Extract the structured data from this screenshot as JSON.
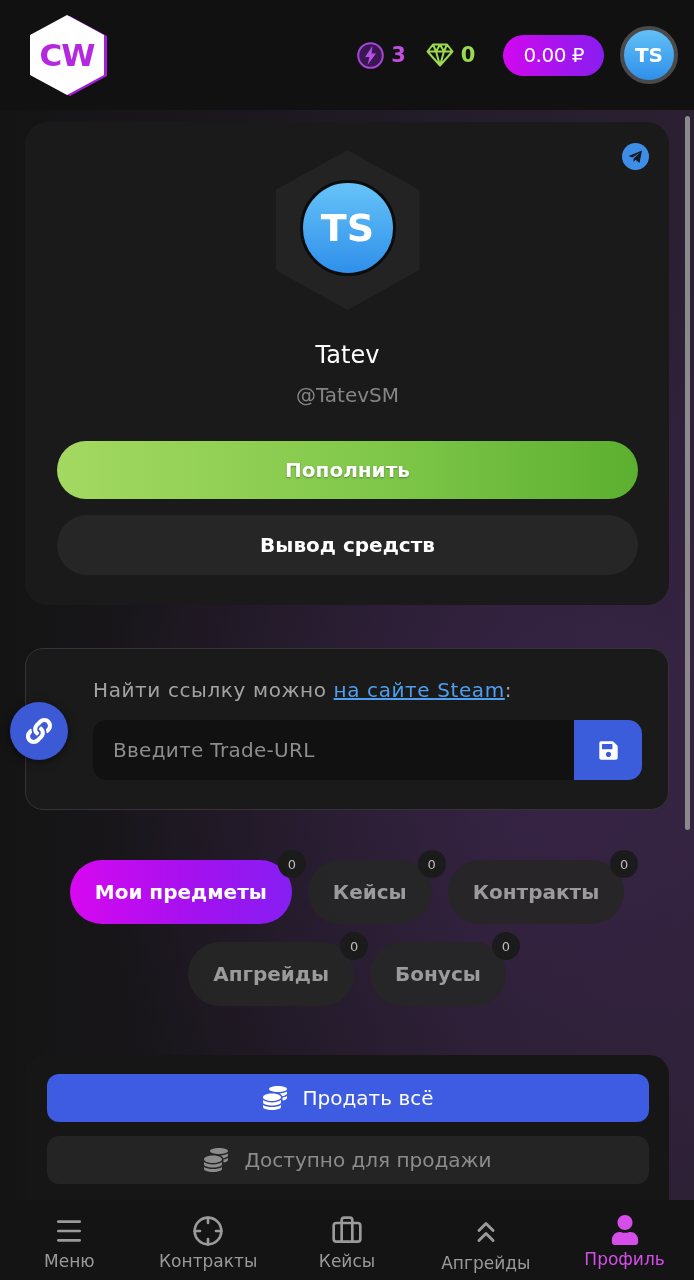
{
  "header": {
    "logo": "CW",
    "energy": "3",
    "gems": "0",
    "balance": "0.00 ₽",
    "avatar": "TS"
  },
  "profile": {
    "avatar": "TS",
    "name": "Tatev",
    "username": "@TatevSM",
    "buttons": [
      {
        "label": "Пополнить",
        "kind": "primary"
      },
      {
        "label": "Вывод средств",
        "kind": "secondary"
      }
    ]
  },
  "trade_url": {
    "hint": "Найти ссылку можно",
    "link": "на сайте Steam",
    "hint_end": ":",
    "placeholder": "Введите Trade-URL"
  },
  "tabs": [
    {
      "label": "Мои предметы",
      "count": "0",
      "selected": true
    },
    {
      "label": "Кейсы",
      "count": "0",
      "selected": false
    },
    {
      "label": "Контракты",
      "count": "0",
      "selected": false
    },
    {
      "label": "Апгрейды",
      "count": "0",
      "selected": false
    },
    {
      "label": "Бонусы",
      "count": "0",
      "selected": false
    }
  ],
  "sell": [
    {
      "label": "Продать всё",
      "kind": "primary"
    },
    {
      "label": "Доступно для продажи",
      "kind": "secondary"
    }
  ],
  "bottom_nav": [
    {
      "label": "Меню",
      "selected": false
    },
    {
      "label": "Контракты",
      "selected": false
    },
    {
      "label": "Кейсы",
      "selected": false
    },
    {
      "label": "Апгрейды",
      "selected": false
    },
    {
      "label": "Профиль",
      "selected": true
    }
  ]
}
